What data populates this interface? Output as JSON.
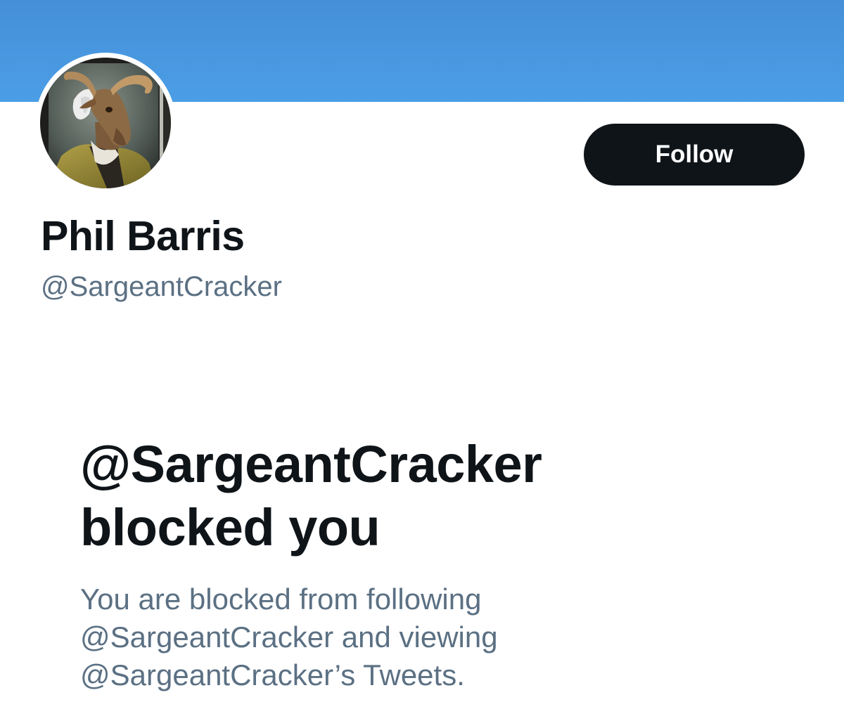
{
  "profile": {
    "display_name": "Phil Barris",
    "handle": "@SargeantCracker",
    "avatar_icon": "goat-portrait-avatar",
    "banner_color": "#4a9be4"
  },
  "actions": {
    "follow_label": "Follow"
  },
  "blocked_notice": {
    "title_line1": "@SargeantCracker",
    "title_line2": "blocked you",
    "desc_line1": "You are blocked from following",
    "desc_line2": "@SargeantCracker and viewing",
    "desc_line3": "@SargeantCracker’s Tweets."
  },
  "colors": {
    "primary_text": "#0f1419",
    "secondary_text": "#5b7083",
    "button_bg": "#0f1419",
    "button_text": "#ffffff"
  }
}
